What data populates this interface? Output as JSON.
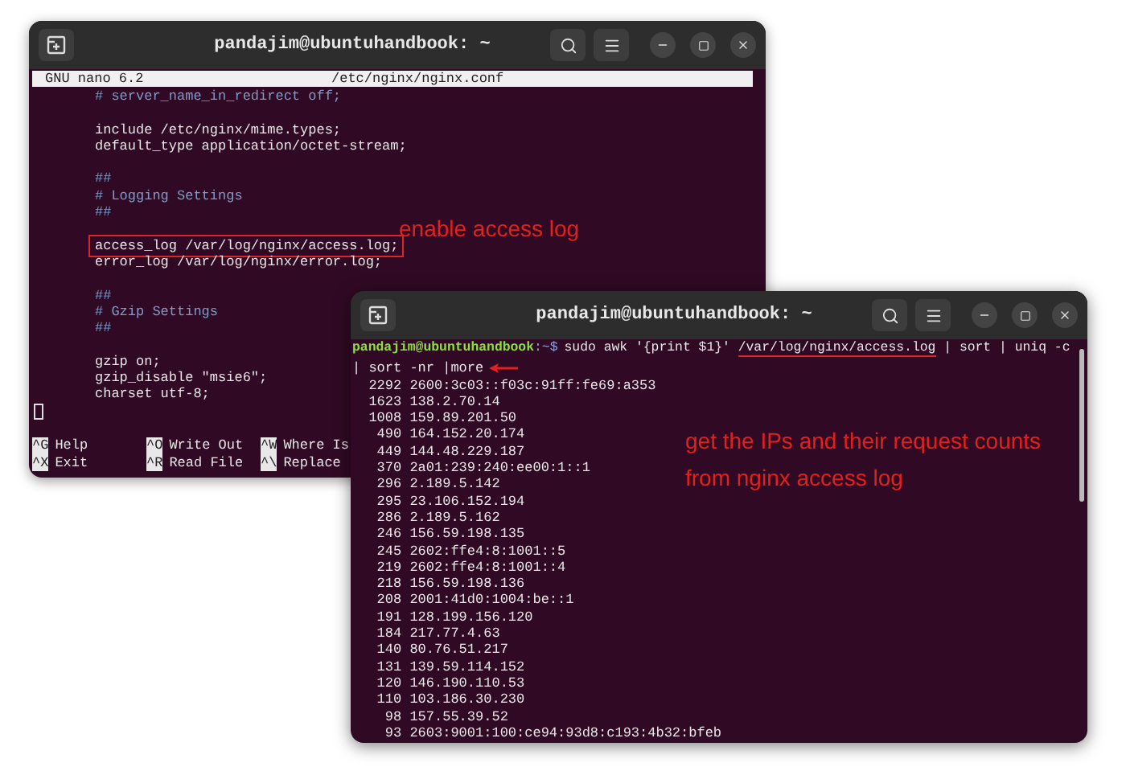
{
  "nano_window": {
    "title": "pandajim@ubuntuhandbook: ~",
    "header": {
      "version": "GNU nano 6.2",
      "file": "/etc/nginx/nginx.conf"
    },
    "lines": [
      {
        "kind": "comment",
        "text": "# server_name_in_redirect off;"
      },
      {
        "kind": "blank"
      },
      {
        "kind": "code",
        "text": "include /etc/nginx/mime.types;"
      },
      {
        "kind": "code",
        "text": "default_type application/octet-stream;"
      },
      {
        "kind": "blank"
      },
      {
        "kind": "comment",
        "text": "##"
      },
      {
        "kind": "comment",
        "text": "# Logging Settings"
      },
      {
        "kind": "comment",
        "text": "##"
      },
      {
        "kind": "blank"
      },
      {
        "kind": "code",
        "text": "access_log /var/log/nginx/access.log;",
        "boxed": true
      },
      {
        "kind": "code",
        "text": "error_log /var/log/nginx/error.log;"
      },
      {
        "kind": "blank"
      },
      {
        "kind": "comment",
        "text": "##"
      },
      {
        "kind": "comment",
        "text": "# Gzip Settings"
      },
      {
        "kind": "comment",
        "text": "##"
      },
      {
        "kind": "blank"
      },
      {
        "kind": "code",
        "text": "gzip on;"
      },
      {
        "kind": "code",
        "text": "gzip_disable \"msie6\";"
      },
      {
        "kind": "code",
        "text": "charset utf-8;"
      },
      {
        "kind": "cursor"
      }
    ],
    "shortcuts": [
      [
        {
          "key": "^G",
          "label": "Help"
        },
        {
          "key": "^O",
          "label": "Write Out"
        },
        {
          "key": "^W",
          "label": "Where Is"
        }
      ],
      [
        {
          "key": "^X",
          "label": "Exit"
        },
        {
          "key": "^R",
          "label": "Read File"
        },
        {
          "key": "^\\",
          "label": "Replace"
        }
      ]
    ],
    "annotation": "enable access log"
  },
  "terminal_window": {
    "title": "pandajim@ubuntuhandbook: ~",
    "prompt_user": "pandajim@ubuntuhandbook",
    "prompt_path": ":~$",
    "command": [
      {
        "text": "sudo awk '{print $1}' ",
        "underlined": false
      },
      {
        "text": "/var/log/nginx/access.log",
        "underlined": true
      },
      {
        "text": " | sort | uniq -c",
        "underlined": false
      }
    ],
    "command_continuation": "| sort -nr |more",
    "output": [
      "  2292 2600:3c03::f03c:91ff:fe69:a353",
      "  1623 138.2.70.14",
      "  1008 159.89.201.50",
      "   490 164.152.20.174",
      "   449 144.48.229.187",
      "   370 2a01:239:240:ee00:1::1",
      "   296 2.189.5.142",
      "   295 23.106.152.194",
      "   286 2.189.5.162",
      "   246 156.59.198.135",
      "   245 2602:ffe4:8:1001::5",
      "   219 2602:ffe4:8:1001::4",
      "   218 156.59.198.136",
      "   208 2001:41d0:1004:be::1",
      "   191 128.199.156.120",
      "   184 217.77.4.63",
      "   140 80.76.51.217",
      "   131 139.59.114.152",
      "   120 146.190.110.53",
      "   110 103.186.30.230",
      "    98 157.55.39.52",
      "    93 2603:9001:100:ce94:93d8:c193:4b32:bfeb"
    ],
    "annotation": [
      "get the IPs and their request counts",
      "from nginx access log"
    ]
  }
}
